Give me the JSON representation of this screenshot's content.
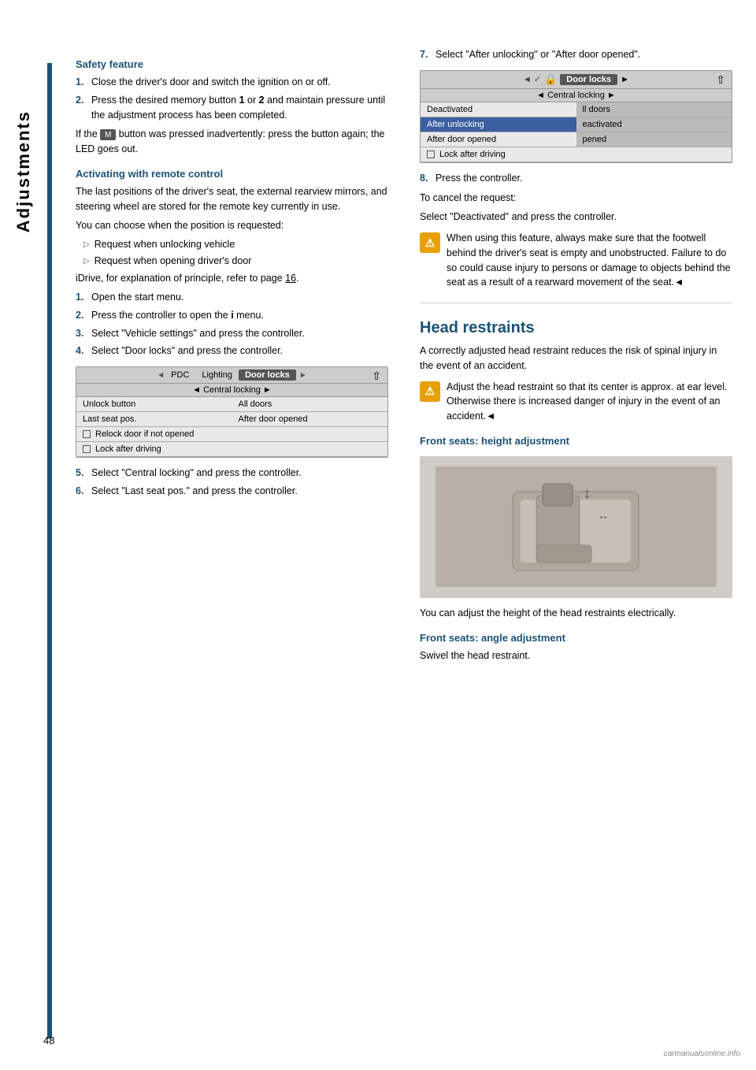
{
  "page": {
    "number": "48",
    "sidebar_label": "Adjustments"
  },
  "left_column": {
    "safety_feature": {
      "heading": "Safety feature",
      "steps": [
        {
          "num": "1.",
          "text": "Close the driver's door and switch the ignition on or off."
        },
        {
          "num": "2.",
          "text": "Press the desired memory button 1 or 2 and maintain pressure until the adjustment process has been completed."
        }
      ],
      "if_button_text": "If the",
      "if_button_mid": "button was pressed inadvertently: press the button again; the LED goes out."
    },
    "activating": {
      "heading": "Activating with remote control",
      "intro": "The last positions of the driver's seat, the external rearview mirrors, and steering wheel are stored for the remote key currently in use.",
      "choose_text": "You can choose when the position is requested:",
      "bullets": [
        "Request when unlocking vehicle",
        "Request when opening driver's door"
      ],
      "idrive_ref": "iDrive, for explanation of principle, refer to page 16.",
      "steps": [
        {
          "num": "1.",
          "text": "Open the start menu."
        },
        {
          "num": "2.",
          "text": "Press the controller to open the i menu."
        },
        {
          "num": "3.",
          "text": "Select \"Vehicle settings\" and press the controller."
        },
        {
          "num": "4.",
          "text": "Select \"Door locks\" and press the controller."
        }
      ]
    },
    "screen1": {
      "top_tabs": [
        "◄ PDC",
        "Lighting",
        "Door locks",
        "►"
      ],
      "sub_bar": "◄ Central locking ►",
      "rows": [
        {
          "left": "Unlock button",
          "right": "All doors"
        },
        {
          "left": "Last seat pos.",
          "right": "After door opened"
        }
      ],
      "checkboxes": [
        "Relock door if not opened",
        "Lock after driving"
      ]
    },
    "steps_after_screen1": [
      {
        "num": "5.",
        "text": "Select \"Central locking\" and press the controller."
      },
      {
        "num": "6.",
        "text": "Select \"Last seat pos.\" and press the controller."
      }
    ]
  },
  "right_column": {
    "step7": {
      "num": "7.",
      "text": "Select \"After unlocking\" or \"After door opened\"."
    },
    "screen2": {
      "top_bar_left": "◄ ✓",
      "top_bar_icon": "🔒",
      "top_bar_label": "Door locks",
      "top_bar_arrow": "►",
      "sub_bar": "◄ Central locking ►",
      "rows": [
        {
          "left": "Deactivated",
          "right": "ll doors",
          "left_highlight": false
        },
        {
          "left": "After unlocking",
          "right": "eactivated",
          "left_highlight": true
        },
        {
          "left": "After door opened",
          "right": "pened",
          "left_highlight": false
        }
      ],
      "checkbox_row": "Lock after driving"
    },
    "step8": {
      "num": "8.",
      "text": "Press the controller."
    },
    "cancel_text": "To cancel the request:",
    "cancel_instruction": "Select \"Deactivated\" and press the controller.",
    "warning1": "When using this feature, always make sure that the footwell behind the driver's seat is empty and unobstructed. Failure to do so could cause injury to persons or damage to objects behind the seat as a result of a rearward movement of the seat.◄",
    "head_restraints": {
      "heading": "Head restraints",
      "intro": "A correctly adjusted head restraint reduces the risk of spinal injury in the event of an accident.",
      "warning2": "Adjust the head restraint so that its center is approx. at ear level. Otherwise there is increased danger of injury in the event of an accident.◄",
      "front_seats_height": {
        "heading": "Front seats: height adjustment",
        "image_alt": "Head restraint adjustment illustration",
        "caption": "You can adjust the height of the head restraints electrically."
      },
      "front_seats_angle": {
        "heading": "Front seats: angle adjustment",
        "text": "Swivel the head restraint."
      }
    }
  }
}
